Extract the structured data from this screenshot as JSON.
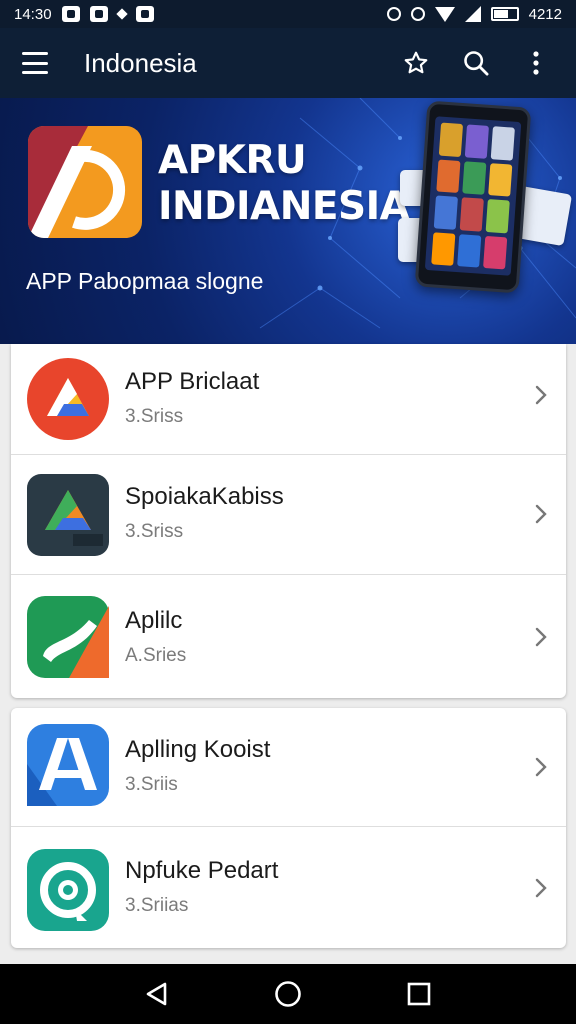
{
  "status_bar": {
    "time_left": "14:30",
    "time_right": "4212",
    "icons": [
      "notification-box-icon",
      "image-icon",
      "diamond-icon",
      "message-icon",
      "vibrate-icon",
      "alarm-icon",
      "wifi-icon",
      "signal-icon",
      "battery-icon"
    ]
  },
  "app_bar": {
    "title": "Indonesia",
    "icons": [
      "menu-icon",
      "star-icon",
      "search-icon",
      "more-vert-icon"
    ]
  },
  "banner": {
    "title_line1": "APKRU",
    "title_line2": "INDIANESIA",
    "slogan": "APP Pabopmaa slogne",
    "colors": {
      "bg_dark": "#081a4d",
      "bg_light": "#2a63d8",
      "logo_orange": "#f39a1f",
      "logo_red": "#a82c3a"
    }
  },
  "list_group_1": [
    {
      "name": "APP Briclaat",
      "subtitle": "3.Sriss",
      "icon": "drive-triangle-icon"
    },
    {
      "name": "SpoiakaKabiss",
      "subtitle": "3.Sriss",
      "icon": "drive-dark-icon"
    },
    {
      "name": "Aplilc",
      "subtitle": "A.Sries",
      "icon": "green-orange-app-icon"
    }
  ],
  "list_group_2": [
    {
      "name": "Aplling Kooist",
      "subtitle": "3.Sriis",
      "icon": "blue-a-icon"
    },
    {
      "name": "Npfuke Pedart",
      "subtitle": "3.Sriias",
      "icon": "teal-circle-icon"
    }
  ],
  "nav_bar": {
    "icons": [
      "back-icon",
      "home-icon",
      "recents-icon"
    ]
  }
}
